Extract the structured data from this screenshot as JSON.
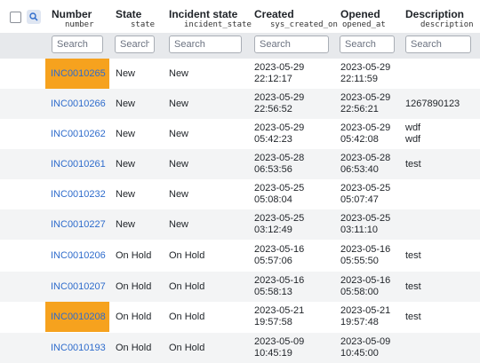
{
  "header": {
    "columns": [
      {
        "title": "Number",
        "field": "number"
      },
      {
        "title": "State",
        "field": "state"
      },
      {
        "title": "Incident state",
        "field": "incident_state"
      },
      {
        "title": "Created",
        "field": "sys_created_on"
      },
      {
        "title": "Opened",
        "field": "opened_at"
      },
      {
        "title": "Description",
        "field": "description"
      }
    ]
  },
  "search": {
    "placeholder": "Search"
  },
  "rows": [
    {
      "number": "INC0010265",
      "highlight": true,
      "state": "New",
      "incident_state": "New",
      "created_date": "2023-05-29",
      "created_time": "22:12:17",
      "opened_date": "2023-05-29",
      "opened_time": "22:11:59",
      "description": [
        "",
        ""
      ]
    },
    {
      "number": "INC0010266",
      "highlight": false,
      "state": "New",
      "incident_state": "New",
      "created_date": "2023-05-29",
      "created_time": "22:56:52",
      "opened_date": "2023-05-29",
      "opened_time": "22:56:21",
      "description": [
        "1267890123",
        ""
      ]
    },
    {
      "number": "INC0010262",
      "highlight": false,
      "state": "New",
      "incident_state": "New",
      "created_date": "2023-05-29",
      "created_time": "05:42:23",
      "opened_date": "2023-05-29",
      "opened_time": "05:42:08",
      "description": [
        "wdf",
        "wdf"
      ]
    },
    {
      "number": "INC0010261",
      "highlight": false,
      "state": "New",
      "incident_state": "New",
      "created_date": "2023-05-28",
      "created_time": "06:53:56",
      "opened_date": "2023-05-28",
      "opened_time": "06:53:40",
      "description": [
        "test",
        ""
      ]
    },
    {
      "number": "INC0010232",
      "highlight": false,
      "state": "New",
      "incident_state": "New",
      "created_date": "2023-05-25",
      "created_time": "05:08:04",
      "opened_date": "2023-05-25",
      "opened_time": "05:07:47",
      "description": [
        "",
        ""
      ]
    },
    {
      "number": "INC0010227",
      "highlight": false,
      "state": "New",
      "incident_state": "New",
      "created_date": "2023-05-25",
      "created_time": "03:12:49",
      "opened_date": "2023-05-25",
      "opened_time": "03:11:10",
      "description": [
        "",
        ""
      ]
    },
    {
      "number": "INC0010206",
      "highlight": false,
      "state": "On Hold",
      "incident_state": "On Hold",
      "created_date": "2023-05-16",
      "created_time": "05:57:06",
      "opened_date": "2023-05-16",
      "opened_time": "05:55:50",
      "description": [
        "test",
        ""
      ]
    },
    {
      "number": "INC0010207",
      "highlight": false,
      "state": "On Hold",
      "incident_state": "On Hold",
      "created_date": "2023-05-16",
      "created_time": "05:58:13",
      "opened_date": "2023-05-16",
      "opened_time": "05:58:00",
      "description": [
        "test",
        ""
      ]
    },
    {
      "number": "INC0010208",
      "highlight": true,
      "state": "On Hold",
      "incident_state": "On Hold",
      "created_date": "2023-05-21",
      "created_time": "19:57:58",
      "opened_date": "2023-05-21",
      "opened_time": "19:57:48",
      "description": [
        "test",
        ""
      ]
    },
    {
      "number": "INC0010193",
      "highlight": false,
      "state": "On Hold",
      "incident_state": "On Hold",
      "created_date": "2023-05-09",
      "created_time": "10:45:19",
      "opened_date": "2023-05-09",
      "opened_time": "10:45:00",
      "description": [
        "",
        ""
      ]
    }
  ],
  "colors": {
    "highlight": "#f6a21e",
    "link": "#2f6ccc",
    "alt_row": "#f3f4f5",
    "search_row": "#e7e9ec"
  }
}
